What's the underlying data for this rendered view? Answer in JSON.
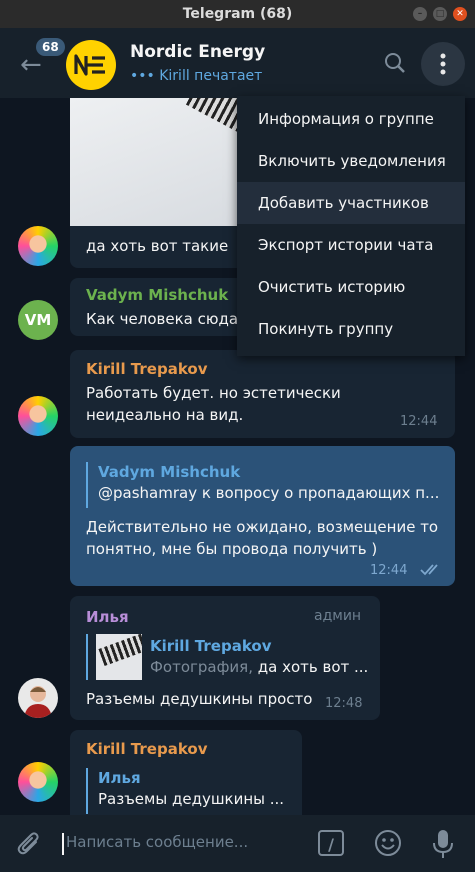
{
  "window": {
    "title": "Telegram (68)"
  },
  "header": {
    "unread_count": "68",
    "group_name": "Nordic Energy",
    "typing": "Kirill печатает",
    "logo_text": "NE"
  },
  "menu": {
    "items": [
      "Информация о группе",
      "Включить уведомления",
      "Добавить участников",
      "Экспорт истории чата",
      "Очистить историю",
      "Покинуть группу"
    ],
    "highlighted": 2
  },
  "messages": [
    {
      "id": "m1",
      "text": "да хоть вот такие"
    },
    {
      "id": "m2",
      "sender": "Vadym Mishchuk",
      "sender_color": "#6cb24e",
      "avatar_initials": "VM",
      "text": "Как человека сюда"
    },
    {
      "id": "m3",
      "sender": "Kirill Trepakov",
      "sender_color": "#e89a4d",
      "text": "Работать будет. но эстетически неидеально на вид.",
      "time": "12:44"
    },
    {
      "id": "m4",
      "outgoing": true,
      "reply_name": "Vadym Mishchuk",
      "reply_text": "@pashamray к вопросу о пропадающих п...",
      "text": "Действительно не ожидано, возмещение то понятно, мне бы провода получить )",
      "time": "12:44"
    },
    {
      "id": "m5",
      "sender": "Илья",
      "sender_color": "#b88ed8",
      "role": "админ",
      "reply_name": "Kirill Trepakov",
      "reply_prefix": "Фотография,",
      "reply_text": "да хоть вот ...",
      "text": "Разъемы дедушкины просто",
      "time": "12:48"
    },
    {
      "id": "m6",
      "sender": "Kirill Trepakov",
      "sender_color": "#e89a4d",
      "reply_name": "Илья",
      "reply_text": "Разъемы дедушкины ..."
    }
  ],
  "composer": {
    "placeholder": "Написать сообщение...",
    "command_label": "/"
  },
  "colors": {
    "accent": "#5fa8e0",
    "bg": "#0e1621",
    "panel": "#17212b",
    "bubble_in": "#182533",
    "bubble_out": "#2b5278"
  }
}
